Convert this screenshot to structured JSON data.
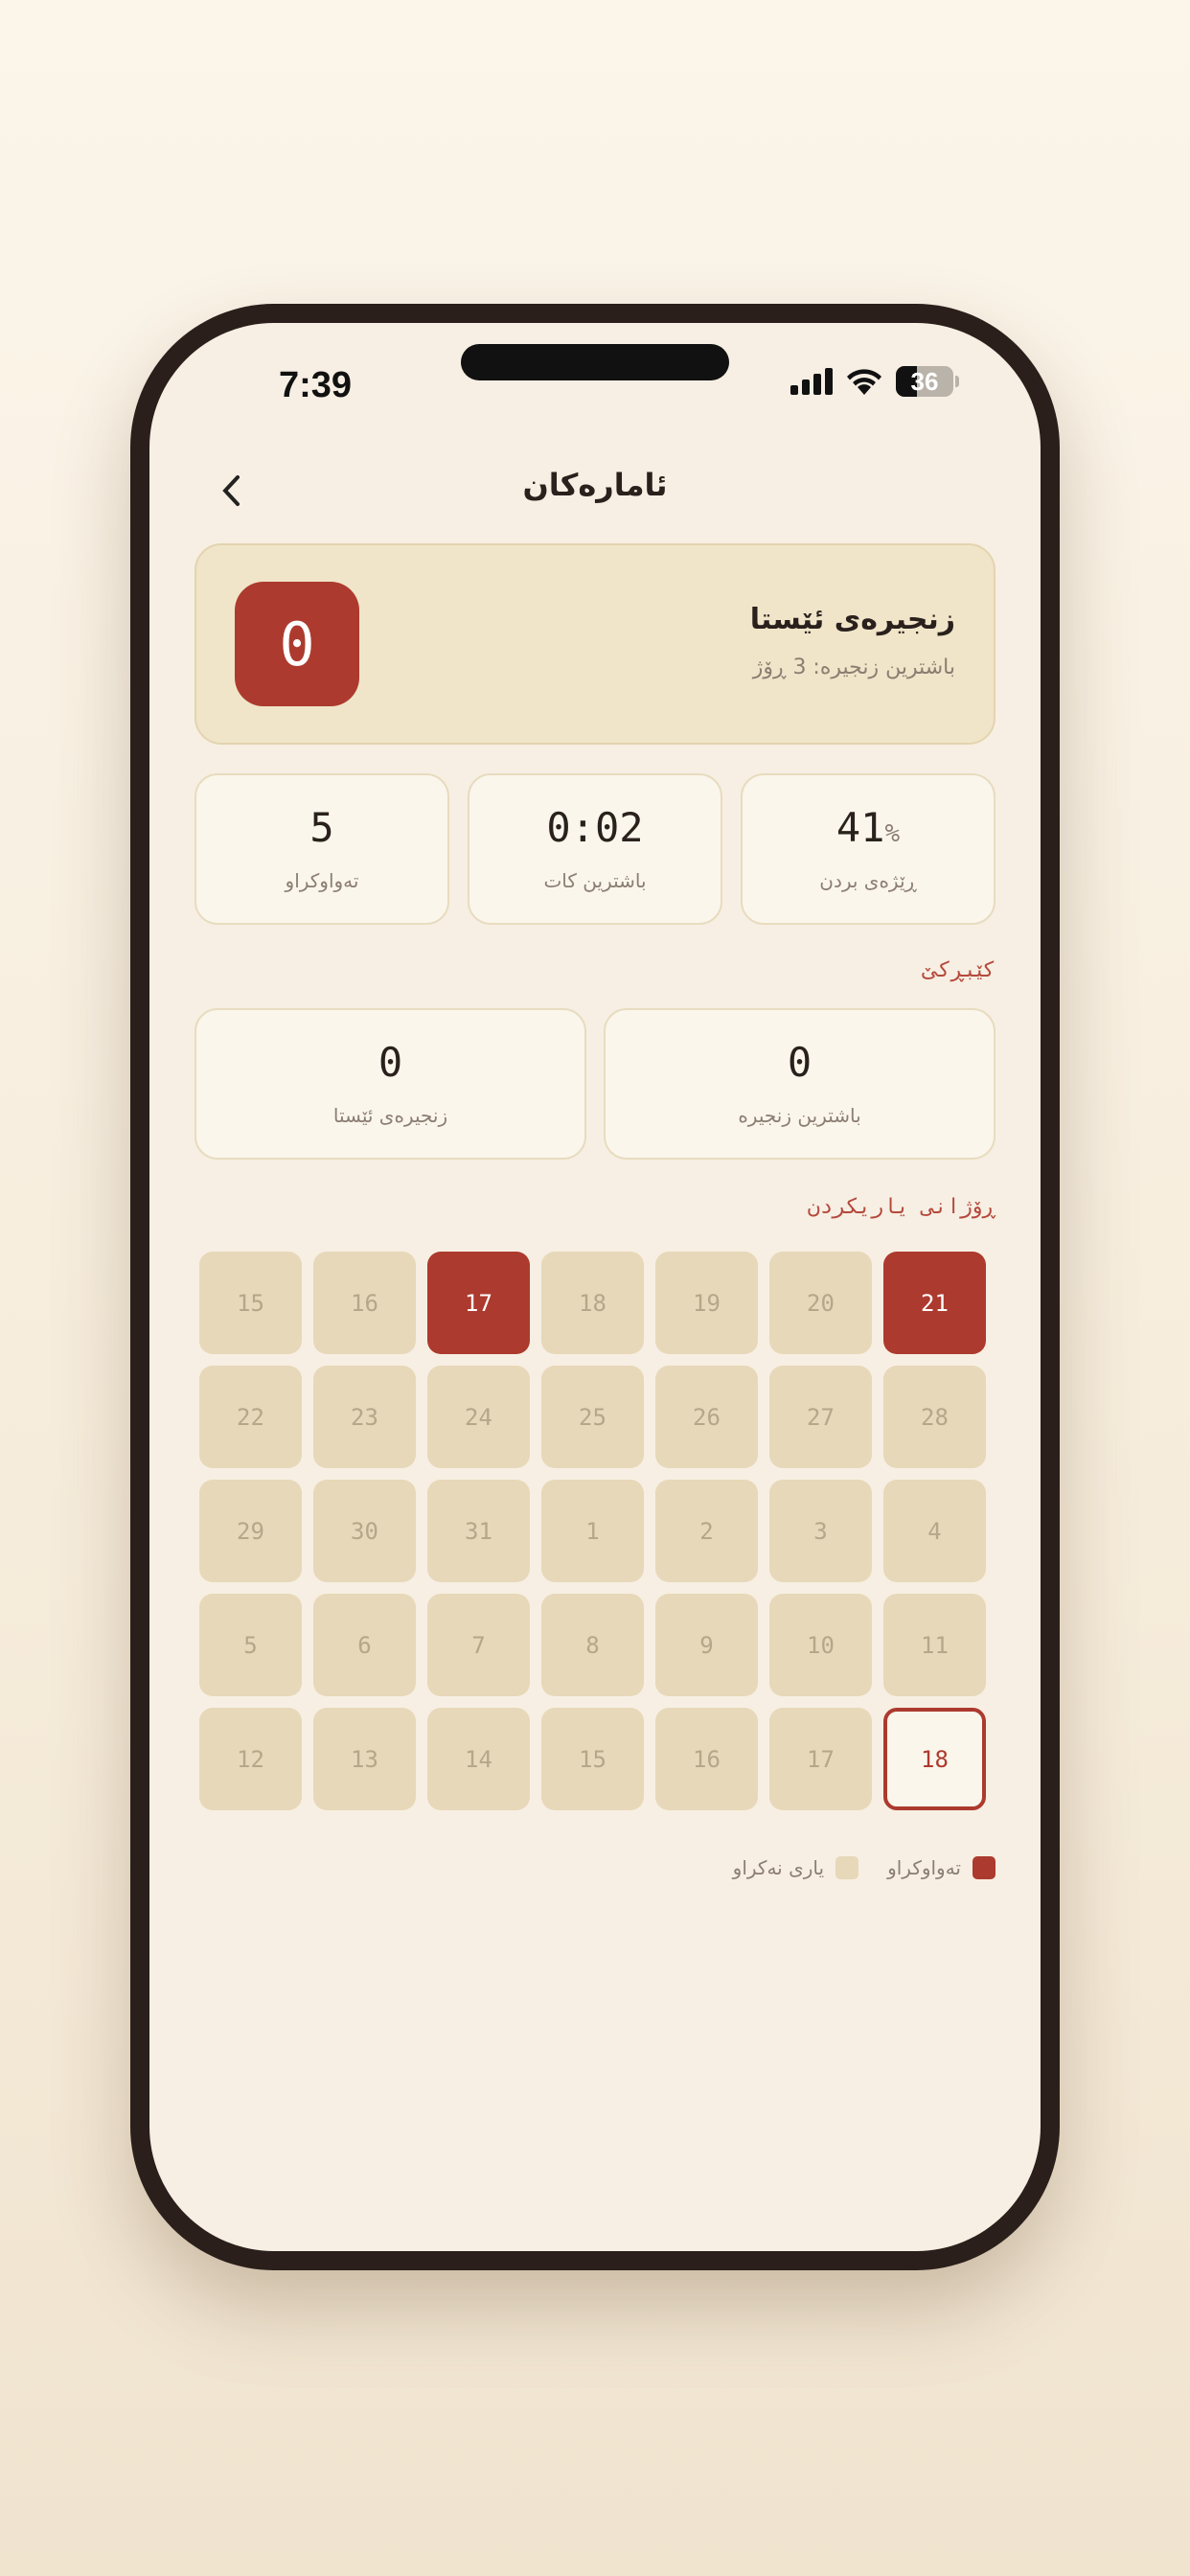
{
  "status": {
    "time": "7:39",
    "battery": "36",
    "battery_level": 0.36
  },
  "header": {
    "title": "ئامارەکان",
    "back_icon": "chevron-left-icon"
  },
  "streak": {
    "value": "0",
    "title": "زنجیرەی ئێستا",
    "subtitle": "باشترین زنجیرە: 3 ڕۆژ"
  },
  "stats": [
    {
      "value": "41",
      "unit": "%",
      "label": "ڕێژەی بردن"
    },
    {
      "value": "0:02",
      "label": "باشترین کات"
    },
    {
      "value": "5",
      "label": "تەواوکراو"
    }
  ],
  "competitive": {
    "label": "کێبڕکێ",
    "items": [
      {
        "value": "0",
        "label": "باشترین زنجیرە"
      },
      {
        "value": "0",
        "label": "زنجیرەی ئێستا"
      }
    ]
  },
  "calendar": {
    "label": "ڕۆژانی یاریکردن",
    "days": [
      {
        "d": "15",
        "s": ""
      },
      {
        "d": "16",
        "s": ""
      },
      {
        "d": "17",
        "s": "done"
      },
      {
        "d": "18",
        "s": ""
      },
      {
        "d": "19",
        "s": ""
      },
      {
        "d": "20",
        "s": ""
      },
      {
        "d": "21",
        "s": "done"
      },
      {
        "d": "22",
        "s": ""
      },
      {
        "d": "23",
        "s": ""
      },
      {
        "d": "24",
        "s": ""
      },
      {
        "d": "25",
        "s": ""
      },
      {
        "d": "26",
        "s": ""
      },
      {
        "d": "27",
        "s": ""
      },
      {
        "d": "28",
        "s": ""
      },
      {
        "d": "29",
        "s": ""
      },
      {
        "d": "30",
        "s": ""
      },
      {
        "d": "31",
        "s": ""
      },
      {
        "d": "1",
        "s": ""
      },
      {
        "d": "2",
        "s": ""
      },
      {
        "d": "3",
        "s": ""
      },
      {
        "d": "4",
        "s": ""
      },
      {
        "d": "5",
        "s": ""
      },
      {
        "d": "6",
        "s": ""
      },
      {
        "d": "7",
        "s": ""
      },
      {
        "d": "8",
        "s": ""
      },
      {
        "d": "9",
        "s": ""
      },
      {
        "d": "10",
        "s": ""
      },
      {
        "d": "11",
        "s": ""
      },
      {
        "d": "12",
        "s": ""
      },
      {
        "d": "13",
        "s": ""
      },
      {
        "d": "14",
        "s": ""
      },
      {
        "d": "15",
        "s": ""
      },
      {
        "d": "16",
        "s": ""
      },
      {
        "d": "17",
        "s": ""
      },
      {
        "d": "18",
        "s": "today"
      }
    ]
  },
  "legend": {
    "completed": "تەواوکراو",
    "not_played": "یاری نەکراو",
    "completed_color": "#ad3a2e",
    "not_played_color": "#e7d8b9"
  }
}
